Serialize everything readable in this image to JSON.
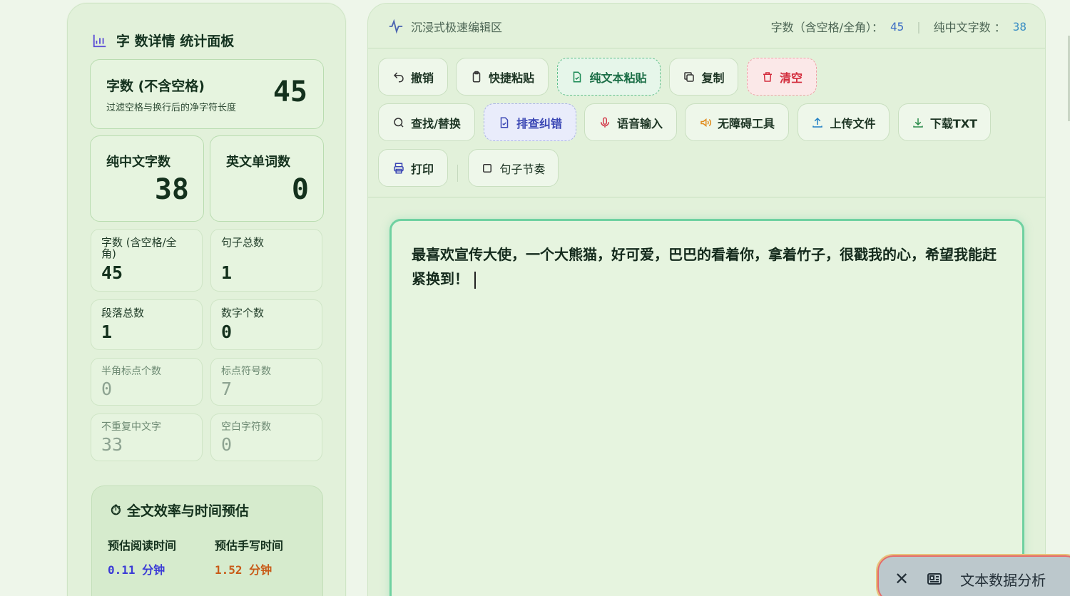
{
  "left_panel": {
    "title": "字 数详情 统计面板",
    "main_card": {
      "label": "字数 (不含空格)",
      "sub": "过滤空格与换行后的净字符长度",
      "value": "45"
    },
    "mid_cards": [
      {
        "label": "纯中文字数",
        "value": "38"
      },
      {
        "label": "英文单词数",
        "value": "0"
      }
    ],
    "small_cards": [
      {
        "label": "字数 (含空格/全角)",
        "value": "45"
      },
      {
        "label": "句子总数",
        "value": "1"
      },
      {
        "label": "段落总数",
        "value": "1"
      },
      {
        "label": "数字个数",
        "value": "0"
      },
      {
        "label": "半角标点个数",
        "value": "0"
      },
      {
        "label": "标点符号数",
        "value": "7"
      },
      {
        "label": "不重复中文字",
        "value": "33"
      },
      {
        "label": "空白字符数",
        "value": "0"
      }
    ],
    "efficiency": {
      "title": "全文效率与时间预估",
      "read_label": "预估阅读时间",
      "read_value": "0.11",
      "read_unit": "分钟",
      "write_label": "预估手写时间",
      "write_value": "1.52",
      "write_unit": "分钟"
    }
  },
  "editor": {
    "title": "沉浸式极速编辑区",
    "stat1_label": "字数（含空格/全角）：",
    "stat1_value": "45",
    "stat2_label": "纯中文字数 ：",
    "stat2_value": "38",
    "buttons": {
      "undo": "撤销",
      "quick_paste": "快捷粘贴",
      "plain_paste": "纯文本粘贴",
      "copy": "复制",
      "clear": "清空",
      "find_replace": "查找/替换",
      "proofread": "排查纠错",
      "voice_input": "语音输入",
      "accessibility": "无障碍工具",
      "upload": "上传文件",
      "download": "下载TXT",
      "print": "打印",
      "sentence_rhythm": "句子节奏"
    },
    "content": "最喜欢宣传大使，一个大熊猫，好可爱，巴巴的看着你，拿着竹子，很戳我的心，希望我能赶紧换到！"
  },
  "analysis_button": {
    "label": "文本数据分析"
  }
}
